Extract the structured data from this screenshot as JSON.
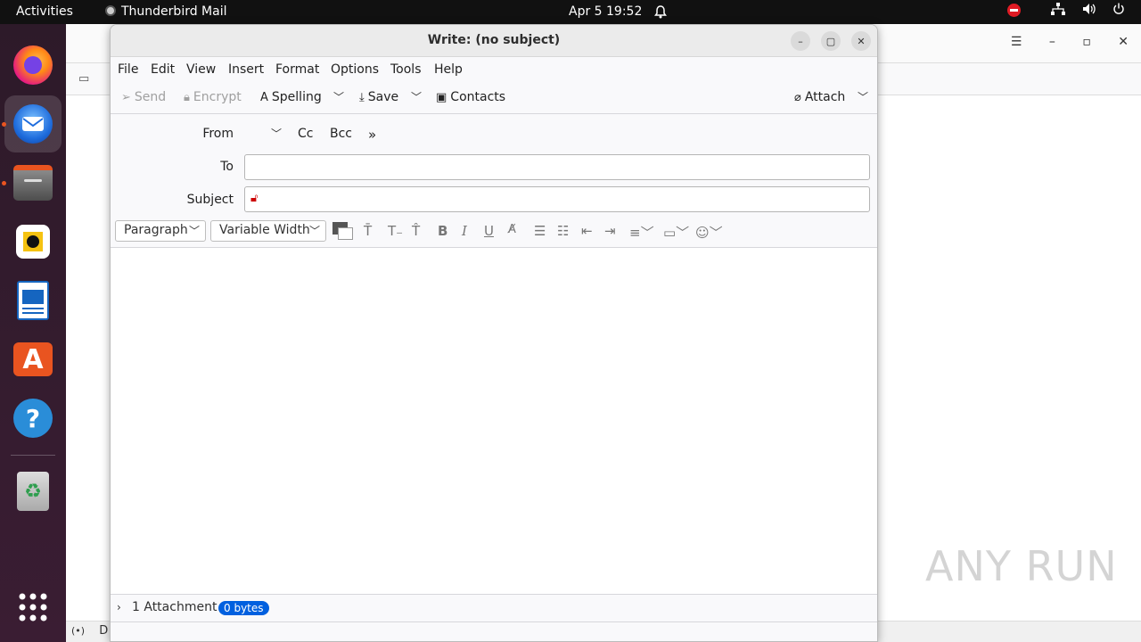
{
  "topbar": {
    "activities": "Activities",
    "app_name": "Thunderbird Mail",
    "clock": "Apr 5  19:52"
  },
  "dock": {
    "items": [
      "firefox",
      "thunderbird",
      "files",
      "rhythmbox",
      "libreoffice-writer",
      "app-center",
      "help",
      "trash",
      "show-apps"
    ]
  },
  "bg_window": {
    "status_text": "D"
  },
  "compose": {
    "title": "Write: (no subject)",
    "menu": [
      "File",
      "Edit",
      "View",
      "Insert",
      "Format",
      "Options",
      "Tools",
      "Help"
    ],
    "toolbar": {
      "send": "Send",
      "encrypt": "Encrypt",
      "spelling": "Spelling",
      "save": "Save",
      "contacts": "Contacts",
      "attach": "Attach"
    },
    "headers": {
      "from_label": "From",
      "cc": "Cc",
      "bcc": "Bcc",
      "to_label": "To",
      "to_value": "",
      "subject_label": "Subject",
      "subject_value": ""
    },
    "format": {
      "paragraph": "Paragraph",
      "font": "Variable Width"
    },
    "attachments": {
      "label": "1 Attachment",
      "size": "0 bytes"
    }
  },
  "watermark": "ANY RUN"
}
